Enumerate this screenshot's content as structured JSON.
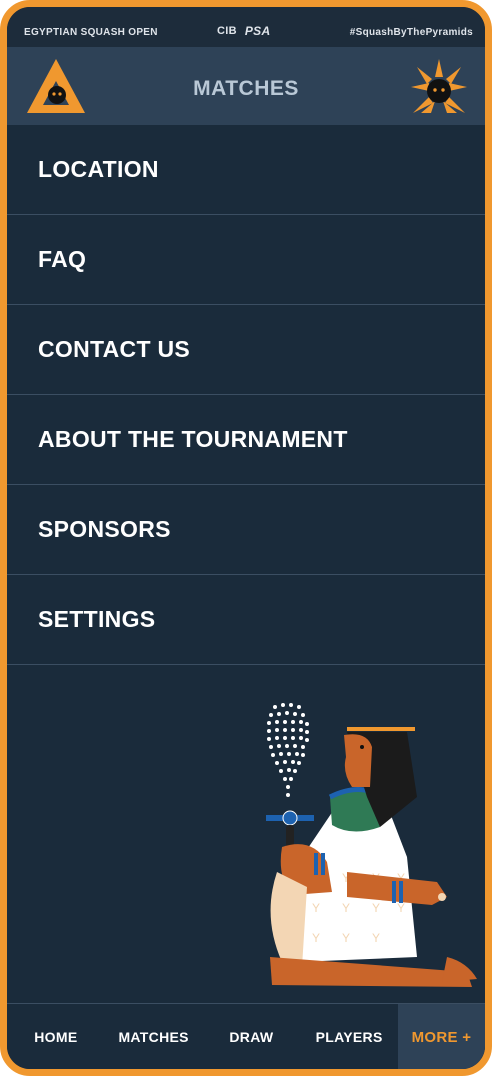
{
  "status_bar": {
    "left": "EGYPTIAN SQUASH OPEN",
    "sponsor_1": "CIB",
    "sponsor_2": "PSA",
    "hashtag": "#SquashByThePyramids"
  },
  "header": {
    "title": "MATCHES"
  },
  "menu": {
    "items": [
      {
        "label": "LOCATION"
      },
      {
        "label": "FAQ"
      },
      {
        "label": "CONTACT US"
      },
      {
        "label": "ABOUT THE TOURNAMENT"
      },
      {
        "label": "SPONSORS"
      },
      {
        "label": "SETTINGS"
      }
    ]
  },
  "tabbar": {
    "tabs": [
      {
        "label": "HOME"
      },
      {
        "label": "MATCHES"
      },
      {
        "label": "DRAW"
      },
      {
        "label": "PLAYERS"
      },
      {
        "label": "MORE +"
      }
    ],
    "active": "MORE +"
  },
  "colors": {
    "accent": "#f0982f",
    "background": "#1a2b3b",
    "header": "#2e4257",
    "text": "#ffffff"
  },
  "icons": [
    "triangle-logo-icon",
    "sun-logo-icon",
    "egyptian-squash-player-illustration"
  ]
}
